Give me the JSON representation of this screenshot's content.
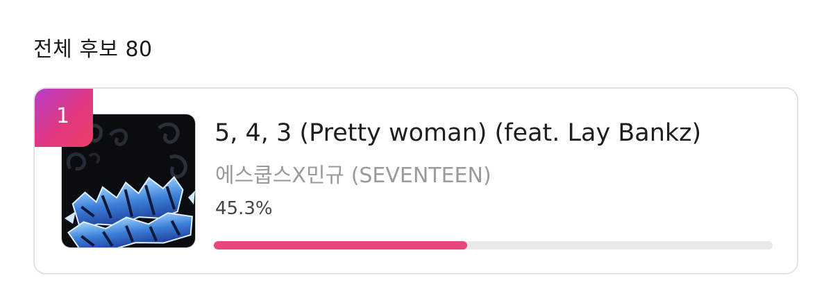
{
  "header": {
    "title": "전체 후보 80"
  },
  "candidate": {
    "rank": "1",
    "cover_icon": "album-cover",
    "song_title": "5, 4, 3 (Pretty woman) (feat. Lay Bankz)",
    "artist": "에스쿱스X민규 (SEVENTEEN)",
    "vote_percent_label": "45.3%",
    "vote_fraction": 0.453
  },
  "colors": {
    "accent": "#e8467f",
    "badge_gradient_start": "#b83ec8",
    "badge_gradient_end": "#ef3f66",
    "track": "#e9e9ec"
  }
}
